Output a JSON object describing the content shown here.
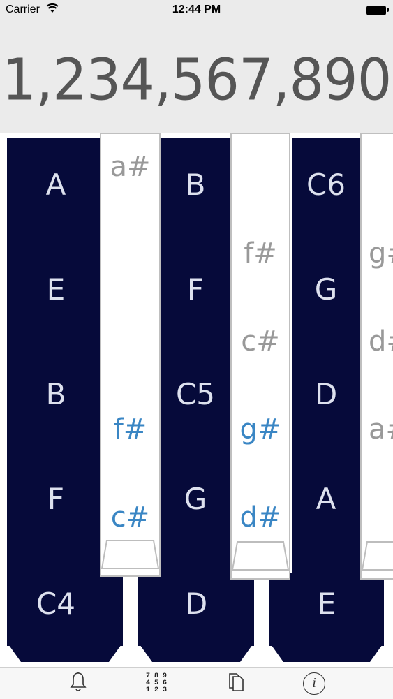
{
  "status": {
    "carrier": "Carrier",
    "time": "12:44 PM"
  },
  "display": {
    "value": "1,234,567,890"
  },
  "dark_pipes": [
    {
      "notes": [
        "A",
        "E",
        "B",
        "F",
        "C4"
      ]
    },
    {
      "notes": [
        "B",
        "F",
        "C5",
        "G",
        "D"
      ]
    },
    {
      "notes": [
        "C6",
        "G",
        "D",
        "A",
        "E"
      ]
    }
  ],
  "light_pipes": [
    {
      "notes": [
        "a#",
        "f#",
        "c#"
      ]
    },
    {
      "notes": [
        "f#",
        "c#",
        "g#",
        "d#"
      ]
    },
    {
      "notes": [
        "g#",
        "d#",
        "a#"
      ]
    }
  ],
  "tabbar": {
    "tabs": [
      {
        "icon": "bell-icon"
      },
      {
        "icon": "numpad-icon",
        "rows": [
          "7 8 9",
          "4 5 6",
          "1 2 3"
        ]
      },
      {
        "icon": "copy-icon"
      },
      {
        "icon": "info-icon",
        "glyph": "i"
      }
    ]
  },
  "colors": {
    "dark_pipe": "#060a3a",
    "accent_blue": "#3a86c4",
    "header_bg": "#ebebeb"
  }
}
